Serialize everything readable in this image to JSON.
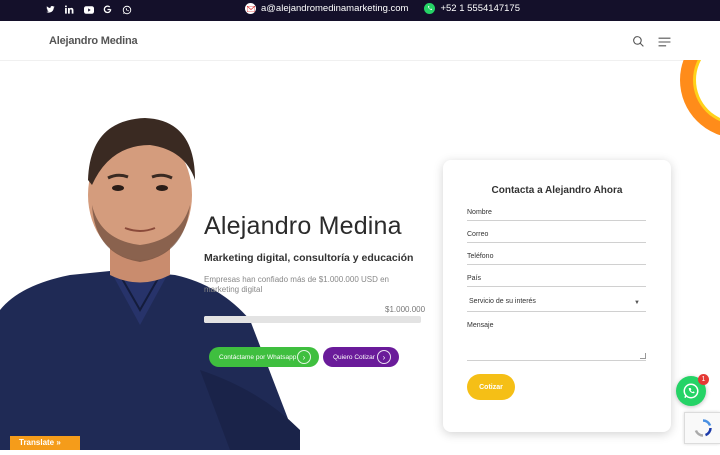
{
  "topbar": {
    "social_icons": [
      "twitter-icon",
      "linkedin-icon",
      "youtube-icon",
      "google-icon",
      "whatsapp-icon"
    ],
    "email": "a@alejandromedinamarketing.com",
    "phone": "+52 1 5554147175"
  },
  "nav": {
    "brand": "Alejandro Medina"
  },
  "hero": {
    "name": "Alejandro Medina",
    "subtitle": "Marketing digital, consultoría y educación",
    "description": "Empresas han confiado más de $1.000.000 USD en marketing digital",
    "progress_label": "$1.000.000",
    "progress_fraction": 1.0,
    "buttons": {
      "whatsapp": "Contáctame por Whatsapp",
      "quote": "Quiero Cotizar"
    }
  },
  "form": {
    "title": "Contacta a Alejandro Ahora",
    "name_placeholder": "Nombre",
    "email_placeholder": "Correo",
    "phone_placeholder": "Teléfono",
    "country_placeholder": "País",
    "service_selected": "Servicio de su interés",
    "message_placeholder": "Mensaje",
    "submit_label": "Cotizar"
  },
  "floating": {
    "whatsapp_badge": "1",
    "translate_label": "Translate »"
  },
  "colors": {
    "topbar": "#14102a",
    "whatsapp_green": "#3fbf3f",
    "quote_purple": "#6a1b9a",
    "submit_yellow": "#f5bf16",
    "translate_orange": "#f59c1a"
  }
}
